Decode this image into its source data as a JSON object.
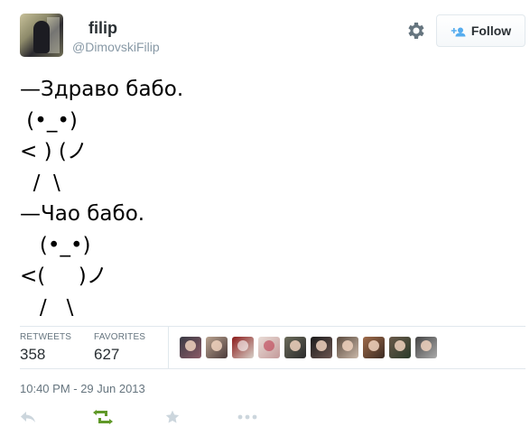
{
  "profile": {
    "fullname": "filip",
    "username": "@DimovskiFilip"
  },
  "follow": {
    "label": "Follow"
  },
  "tweet": {
    "text": "—Здраво бабо.\n (•_•)\n< ) (ノ\n  /  \\\n—Чао бабо.\n   (•_•)\n<(     )ノ\n   /   \\"
  },
  "stats": {
    "retweets": {
      "label": "RETWEETS",
      "value": "358"
    },
    "favorites": {
      "label": "FAVORITES",
      "value": "627"
    }
  },
  "timestamp": "10:40 PM - 29 Jun 2013",
  "colors": {
    "retweet_active": "#609928",
    "icon_gray": "#ccd6dd",
    "follow_icon": "#55acee"
  }
}
